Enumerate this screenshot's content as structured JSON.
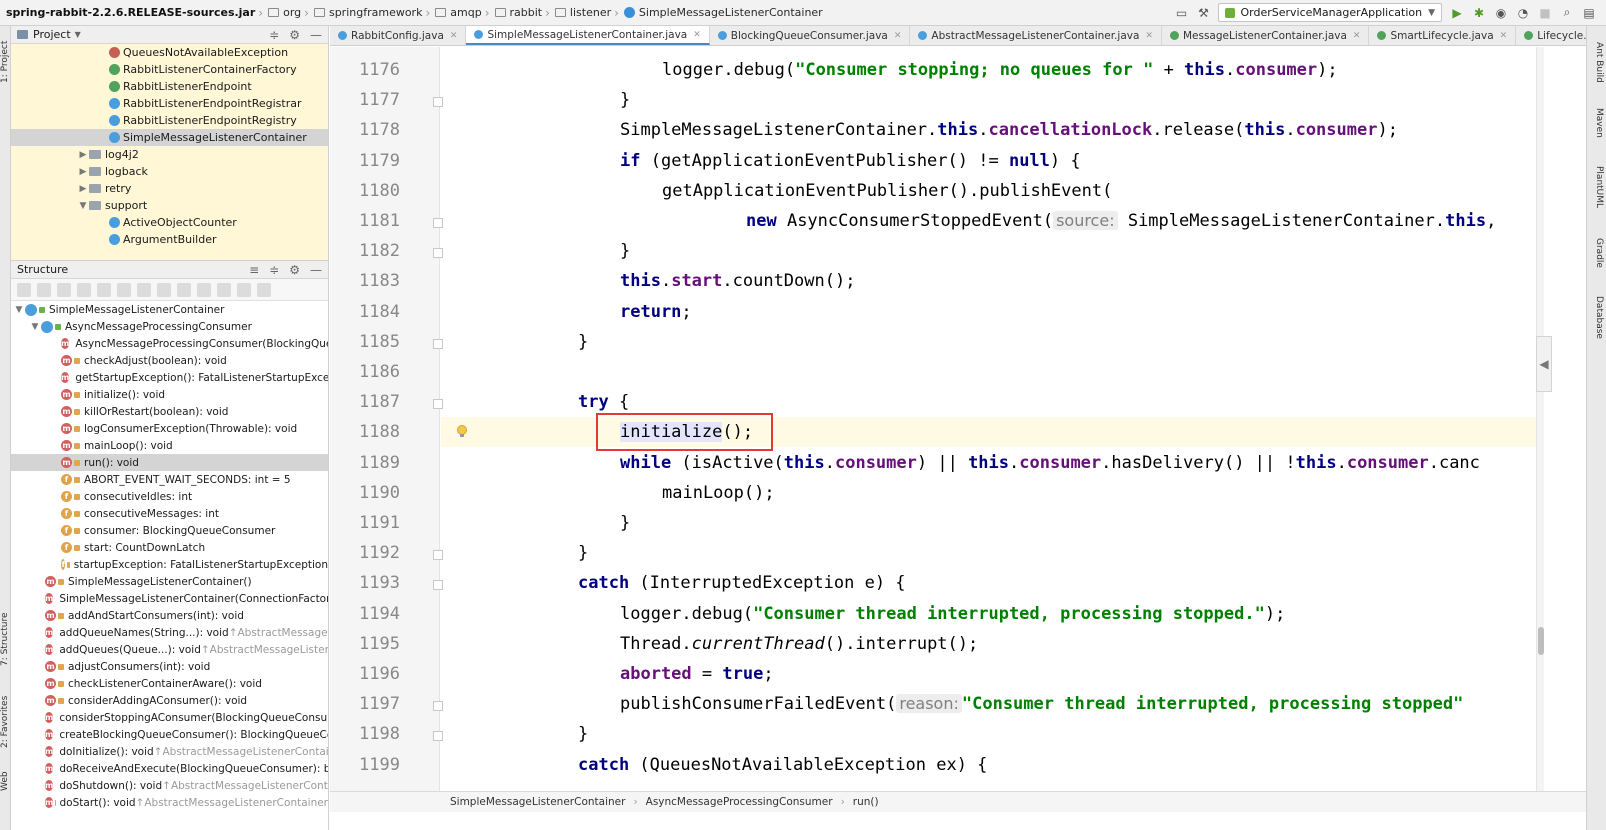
{
  "breadcrumbs": [
    "spring-rabbit-2.2.6.RELEASE-sources.jar",
    "org",
    "springframework",
    "amqp",
    "rabbit",
    "listener",
    "SimpleMessageListenerContainer"
  ],
  "run_config": "OrderServiceManagerApplication",
  "left_tabs": [
    "1: Project",
    "7: Structure",
    "2: Favorites",
    "Web"
  ],
  "right_tabs": [
    "Ant Build",
    "Maven",
    "PlantUML",
    "Gradle",
    "Database"
  ],
  "project": {
    "title": "Project",
    "items": [
      {
        "label": "QueuesNotAvailableException",
        "kind": "e"
      },
      {
        "label": "RabbitListenerContainerFactory",
        "kind": "i"
      },
      {
        "label": "RabbitListenerEndpoint",
        "kind": "i"
      },
      {
        "label": "RabbitListenerEndpointRegistrar",
        "kind": "c"
      },
      {
        "label": "RabbitListenerEndpointRegistry",
        "kind": "c"
      },
      {
        "label": "SimpleMessageListenerContainer",
        "kind": "c"
      },
      {
        "label": "log4j2",
        "kind": "folder"
      },
      {
        "label": "logback",
        "kind": "folder"
      },
      {
        "label": "retry",
        "kind": "folder"
      },
      {
        "label": "support",
        "kind": "folder"
      },
      {
        "label": "ActiveObjectCounter",
        "kind": "c"
      },
      {
        "label": "ArgumentBuilder",
        "kind": "c"
      }
    ]
  },
  "structure": {
    "title": "Structure",
    "root": "SimpleMessageListenerContainer",
    "inner": "AsyncMessageProcessingConsumer",
    "members": [
      {
        "label": "AsyncMessageProcessingConsumer(BlockingQueu",
        "kind": "m"
      },
      {
        "label": "checkAdjust(boolean): void",
        "kind": "m"
      },
      {
        "label": "getStartupException(): FatalListenerStartupExceptio",
        "kind": "m"
      },
      {
        "label": "initialize(): void",
        "kind": "m"
      },
      {
        "label": "killOrRestart(boolean): void",
        "kind": "m"
      },
      {
        "label": "logConsumerException(Throwable): void",
        "kind": "m"
      },
      {
        "label": "mainLoop(): void",
        "kind": "m"
      },
      {
        "label": "run(): void",
        "kind": "m"
      },
      {
        "label": "ABORT_EVENT_WAIT_SECONDS: int = 5",
        "kind": "f"
      },
      {
        "label": "consecutiveIdles: int",
        "kind": "f"
      },
      {
        "label": "consecutiveMessages: int",
        "kind": "f"
      },
      {
        "label": "consumer: BlockingQueueConsumer",
        "kind": "f"
      },
      {
        "label": "start: CountDownLatch",
        "kind": "f"
      },
      {
        "label": "startupException: FatalListenerStartupException",
        "kind": "f"
      }
    ],
    "outer_members": [
      {
        "label": "SimpleMessageListenerContainer()",
        "extra": ""
      },
      {
        "label": "SimpleMessageListenerContainer(ConnectionFactory)",
        "extra": ""
      },
      {
        "label": "addAndStartConsumers(int): void",
        "extra": ""
      },
      {
        "label": "addQueueNames(String...): void",
        "extra": "↑AbstractMessageLis"
      },
      {
        "label": "addQueues(Queue...): void",
        "extra": "↑AbstractMessageListener"
      },
      {
        "label": "adjustConsumers(int): void",
        "extra": ""
      },
      {
        "label": "checkListenerContainerAware(): void",
        "extra": ""
      },
      {
        "label": "considerAddingAConsumer(): void",
        "extra": ""
      },
      {
        "label": "considerStoppingAConsumer(BlockingQueueConsume",
        "extra": ""
      },
      {
        "label": "createBlockingQueueConsumer(): BlockingQueueCons",
        "extra": ""
      },
      {
        "label": "doInitialize(): void",
        "extra": "↑AbstractMessageListenerContaine"
      },
      {
        "label": "doReceiveAndExecute(BlockingQueueConsumer): boo",
        "extra": ""
      },
      {
        "label": "doShutdown(): void",
        "extra": "↑AbstractMessageListenerContain"
      },
      {
        "label": "doStart(): void",
        "extra": "↑AbstractMessageListenerContainer"
      }
    ]
  },
  "tabs": [
    {
      "label": "RabbitConfig.java",
      "kind": "c",
      "active": false
    },
    {
      "label": "SimpleMessageListenerContainer.java",
      "kind": "c",
      "active": true
    },
    {
      "label": "BlockingQueueConsumer.java",
      "kind": "c",
      "active": false
    },
    {
      "label": "AbstractMessageListenerContainer.java",
      "kind": "c",
      "active": false
    },
    {
      "label": "MessageListenerContainer.java",
      "kind": "i",
      "active": false
    },
    {
      "label": "SmartLifecycle.java",
      "kind": "i",
      "active": false
    },
    {
      "label": "Lifecycle.java",
      "kind": "i",
      "active": false
    }
  ],
  "code_lines": [
    {
      "n": "1176",
      "indent": 2,
      "parts": [
        [
          "t",
          "logger"
        ],
        [
          "t",
          "."
        ],
        [
          "t",
          "debug("
        ],
        [
          "s",
          "\"Consumer stopping; no queues for \""
        ],
        [
          "t",
          " + "
        ],
        [
          "k",
          "this"
        ],
        [
          "t",
          "."
        ],
        [
          "f",
          "consumer"
        ],
        [
          "t",
          ");"
        ]
      ]
    },
    {
      "n": "1177",
      "indent": 1,
      "parts": [
        [
          "t",
          "}"
        ]
      ]
    },
    {
      "n": "1178",
      "indent": 1,
      "parts": [
        [
          "t",
          "SimpleMessageListenerContainer."
        ],
        [
          "k",
          "this"
        ],
        [
          "t",
          "."
        ],
        [
          "f",
          "cancellationLock"
        ],
        [
          "t",
          ".release("
        ],
        [
          "k",
          "this"
        ],
        [
          "t",
          "."
        ],
        [
          "f",
          "consumer"
        ],
        [
          "t",
          ");"
        ]
      ]
    },
    {
      "n": "1179",
      "indent": 1,
      "parts": [
        [
          "k",
          "if"
        ],
        [
          "t",
          " (getApplicationEventPublisher() != "
        ],
        [
          "k",
          "null"
        ],
        [
          "t",
          ") {"
        ]
      ]
    },
    {
      "n": "1180",
      "indent": 2,
      "parts": [
        [
          "t",
          "getApplicationEventPublisher().publishEvent("
        ]
      ]
    },
    {
      "n": "1181",
      "indent": 4,
      "parts": [
        [
          "k",
          "new"
        ],
        [
          "t",
          " AsyncConsumerStoppedEvent("
        ],
        [
          "h",
          "source:"
        ],
        [
          "t",
          " SimpleMessageListenerContainer."
        ],
        [
          "k",
          "this"
        ],
        [
          "t",
          ","
        ]
      ]
    },
    {
      "n": "1182",
      "indent": 1,
      "parts": [
        [
          "t",
          "}"
        ]
      ]
    },
    {
      "n": "1183",
      "indent": 1,
      "parts": [
        [
          "k",
          "this"
        ],
        [
          "t",
          "."
        ],
        [
          "f",
          "start"
        ],
        [
          "t",
          ".countDown();"
        ]
      ]
    },
    {
      "n": "1184",
      "indent": 1,
      "parts": [
        [
          "k",
          "return"
        ],
        [
          "t",
          ";"
        ]
      ]
    },
    {
      "n": "1185",
      "indent": 0,
      "parts": [
        [
          "t",
          "}"
        ]
      ]
    },
    {
      "n": "1186",
      "indent": 0,
      "parts": []
    },
    {
      "n": "1187",
      "indent": 0,
      "parts": [
        [
          "k",
          "try"
        ],
        [
          "t",
          " {"
        ]
      ]
    },
    {
      "n": "1188",
      "indent": 1,
      "parts": [
        [
          "w",
          "initialize"
        ],
        [
          "t",
          "();"
        ]
      ],
      "current": true
    },
    {
      "n": "1189",
      "indent": 1,
      "parts": [
        [
          "k",
          "while"
        ],
        [
          "t",
          " (isActive("
        ],
        [
          "k",
          "this"
        ],
        [
          "t",
          "."
        ],
        [
          "f",
          "consumer"
        ],
        [
          "t",
          ") || "
        ],
        [
          "k",
          "this"
        ],
        [
          "t",
          "."
        ],
        [
          "f",
          "consumer"
        ],
        [
          "t",
          ".hasDelivery() || !"
        ],
        [
          "k",
          "this"
        ],
        [
          "t",
          "."
        ],
        [
          "f",
          "consumer"
        ],
        [
          "t",
          ".canc"
        ]
      ]
    },
    {
      "n": "1190",
      "indent": 2,
      "parts": [
        [
          "t",
          "mainLoop();"
        ]
      ]
    },
    {
      "n": "1191",
      "indent": 1,
      "parts": [
        [
          "t",
          "}"
        ]
      ]
    },
    {
      "n": "1192",
      "indent": 0,
      "parts": [
        [
          "t",
          "}"
        ]
      ]
    },
    {
      "n": "1193",
      "indent": 0,
      "parts": [
        [
          "k",
          "catch"
        ],
        [
          "t",
          " (InterruptedException e) {"
        ]
      ]
    },
    {
      "n": "1194",
      "indent": 1,
      "parts": [
        [
          "t",
          "logger"
        ],
        [
          "t",
          ".debug("
        ],
        [
          "s",
          "\"Consumer thread interrupted, processing stopped.\""
        ],
        [
          "t",
          ");"
        ]
      ]
    },
    {
      "n": "1195",
      "indent": 1,
      "parts": [
        [
          "t",
          "Thread."
        ],
        [
          "i",
          "currentThread"
        ],
        [
          "t",
          "().interrupt();"
        ]
      ]
    },
    {
      "n": "1196",
      "indent": 1,
      "parts": [
        [
          "f",
          "aborted"
        ],
        [
          "t",
          " = "
        ],
        [
          "k",
          "true"
        ],
        [
          "t",
          ";"
        ]
      ]
    },
    {
      "n": "1197",
      "indent": 1,
      "parts": [
        [
          "t",
          "publishConsumerFailedEvent("
        ],
        [
          "h",
          "reason:"
        ],
        [
          "s",
          "\"Consumer thread interrupted, processing stopped\""
        ]
      ]
    },
    {
      "n": "1198",
      "indent": 0,
      "parts": [
        [
          "t",
          "}"
        ]
      ]
    },
    {
      "n": "1199",
      "indent": 0,
      "parts": [
        [
          "k",
          "catch"
        ],
        [
          "t",
          " (QueuesNotAvailableException ex) {"
        ]
      ]
    }
  ],
  "status_crumbs": [
    "SimpleMessageListenerContainer",
    "AsyncMessageProcessingConsumer",
    "run()"
  ],
  "colors": {
    "keyword": "#000080",
    "field": "#660e7a",
    "string": "#008000",
    "highlight_box": "#e53935",
    "project_bg": "#fff7d6"
  }
}
